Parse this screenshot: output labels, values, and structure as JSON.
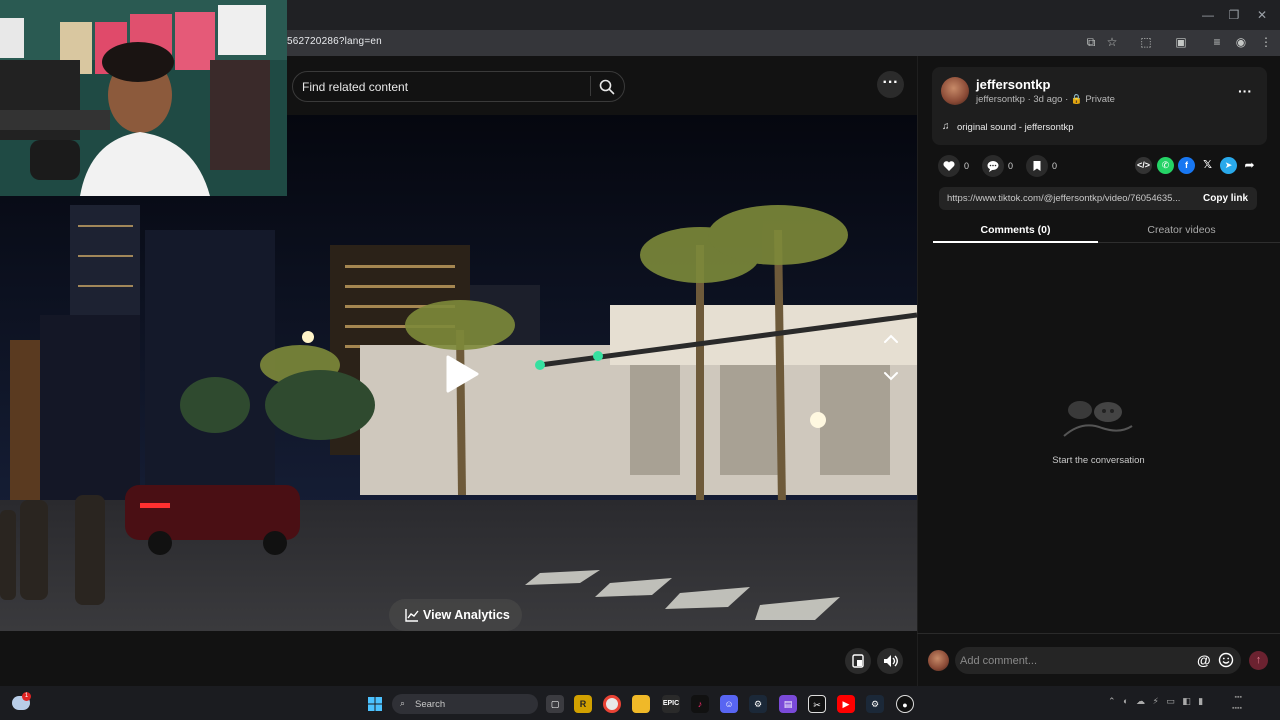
{
  "browser": {
    "url": "562720286?lang=en"
  },
  "search": {
    "placeholder": "Find related content"
  },
  "video": {
    "analytics_label": "View Analytics"
  },
  "author": {
    "name": "jeffersontkp",
    "meta": "jeffersontkp · 3d ago · 🔒 Private",
    "sound": "original sound - jeffersontkp"
  },
  "stats": {
    "likes": "0",
    "comments": "0",
    "saves": "0"
  },
  "share": {
    "link": "https://www.tiktok.com/@jeffersontkp/video/76054635...",
    "copy_label": "Copy link"
  },
  "tabs": [
    {
      "label": "Comments (0)",
      "active": true
    },
    {
      "label": "Creator videos",
      "active": false
    }
  ],
  "comments": {
    "empty_text": "Start the conversation",
    "input_placeholder": "Add comment..."
  },
  "taskbar": {
    "search_label": "Search",
    "icons": [
      "windows-start-icon",
      "search-icon",
      "task-view-icon",
      "roblox-icon",
      "chrome-icon",
      "file-explorer-icon",
      "epic-games-icon",
      "tiktok-icon",
      "discord-icon",
      "steam-icon",
      "app-icon",
      "capcut-icon",
      "youtube-icon",
      "steam-icon-2",
      "obs-icon"
    ]
  },
  "colors": {
    "background": "#121212",
    "card": "#1e1e1e",
    "accent_send": "#6b2230",
    "whatsapp": "#25d366",
    "facebook": "#1877f2",
    "telegram": "#29a9eb"
  }
}
